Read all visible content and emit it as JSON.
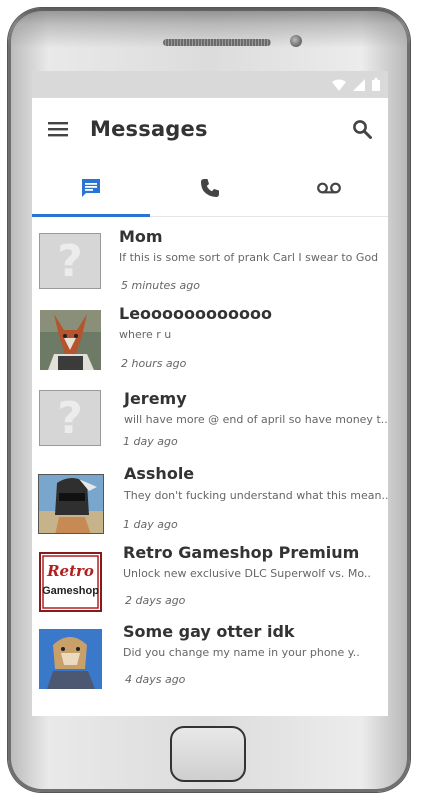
{
  "app": {
    "title": "Messages"
  },
  "icons": {
    "menu": "hamburger-menu",
    "search": "search",
    "tab_messages": "chat-bubble",
    "tab_calls": "phone",
    "tab_voicemail": "voicemail",
    "status_wifi": "wifi",
    "status_signal": "signal",
    "status_battery": "battery"
  },
  "colors": {
    "accent": "#2a74d6",
    "text_primary": "#333333",
    "text_secondary": "#666666"
  },
  "tabs": [
    {
      "icon": "chat-bubble",
      "selected": true
    },
    {
      "icon": "phone",
      "selected": false
    },
    {
      "icon": "voicemail",
      "selected": false
    }
  ],
  "conversations": [
    {
      "name": "Mom",
      "preview": "If this is some sort of prank Carl I swear to God",
      "time": "5 minutes ago",
      "avatar": "placeholder"
    },
    {
      "name": "Leoooooooooooo",
      "preview": "where r u",
      "time": "2 hours ago",
      "avatar": "fox-photo"
    },
    {
      "name": "Jeremy",
      "preview": "will have more @ end of april so have money t..",
      "time": "1 day ago",
      "avatar": "placeholder"
    },
    {
      "name": "Asshole",
      "preview": "They don't fucking understand what this mean..",
      "time": "1 day ago",
      "avatar": "masked-character-photo"
    },
    {
      "name": "Retro Gameshop Premium",
      "preview": "Unlock new exclusive DLC Superwolf vs. Mo..",
      "time": "2 days ago",
      "avatar": "retro-gameshop-logo",
      "logo_text": [
        "Retro",
        "Gameshop"
      ]
    },
    {
      "name": "Some gay otter idk",
      "preview": "Did you change my name in your phone y..",
      "time": "4 days ago",
      "avatar": "otter-photo"
    }
  ]
}
